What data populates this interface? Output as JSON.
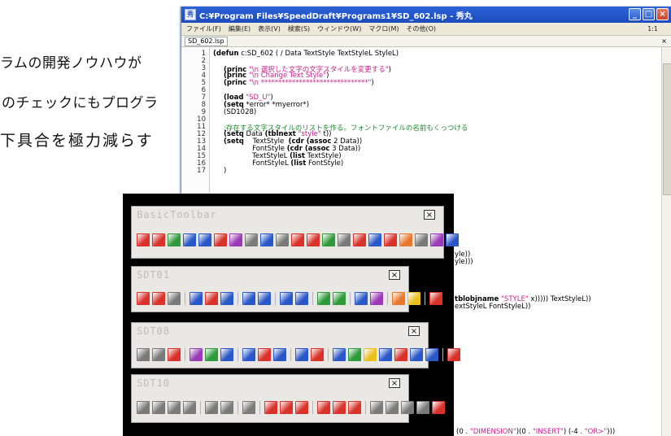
{
  "background_text": {
    "line1": "ラムの開発ノウハウが",
    "line2": "のチェックにもプログラ",
    "line3": "下具合を極力減らす"
  },
  "editor": {
    "window_title": "C:¥Program Files¥SpeedDraft¥Programs1¥SD_602.lsp - 秀丸",
    "menu": [
      "ファイル(F)",
      "編集(E)",
      "表示(V)",
      "検索(S)",
      "ウィンドウ(W)",
      "マクロ(M)",
      "その他(O)"
    ],
    "zoom": "1:1",
    "tab": "SD_602.lsp",
    "tab_close": "×",
    "line_numbers": [
      "1",
      "2",
      "3",
      "4",
      "5",
      "6",
      "7",
      "8",
      "9",
      "10",
      "11",
      "12",
      "13",
      "14",
      "15",
      "16",
      "17"
    ],
    "partial_lines": {
      "a": "yle))",
      "b": "yle)))",
      "c1": "tblobjname",
      "c2": "\"STYLE\"",
      "c3": " x))))) TextStyleL))",
      "d": "extStyleL FontStyleL))",
      "e1": "(0 . ",
      "e2": "\"DIMENSION\"",
      "e3": ")(0 . ",
      "e4": "\"INSERT\"",
      "e5": ") (-4 . ",
      "e6": "\"OR>\"",
      "e7": ")))"
    }
  },
  "toolbars": [
    {
      "title": "BasicToolbar",
      "close": "×"
    },
    {
      "title": "SDT01",
      "close": "×"
    },
    {
      "title": "SDT08",
      "close": "×"
    },
    {
      "title": "SDT10",
      "close": "×"
    }
  ],
  "icon_colors": {
    "red": "#d8322a",
    "blue": "#2a58c8",
    "green": "#2e9a3a",
    "gray": "#7a7a7a",
    "yellow": "#e8c020",
    "purple": "#9a3ab8",
    "orange": "#e8782a"
  }
}
